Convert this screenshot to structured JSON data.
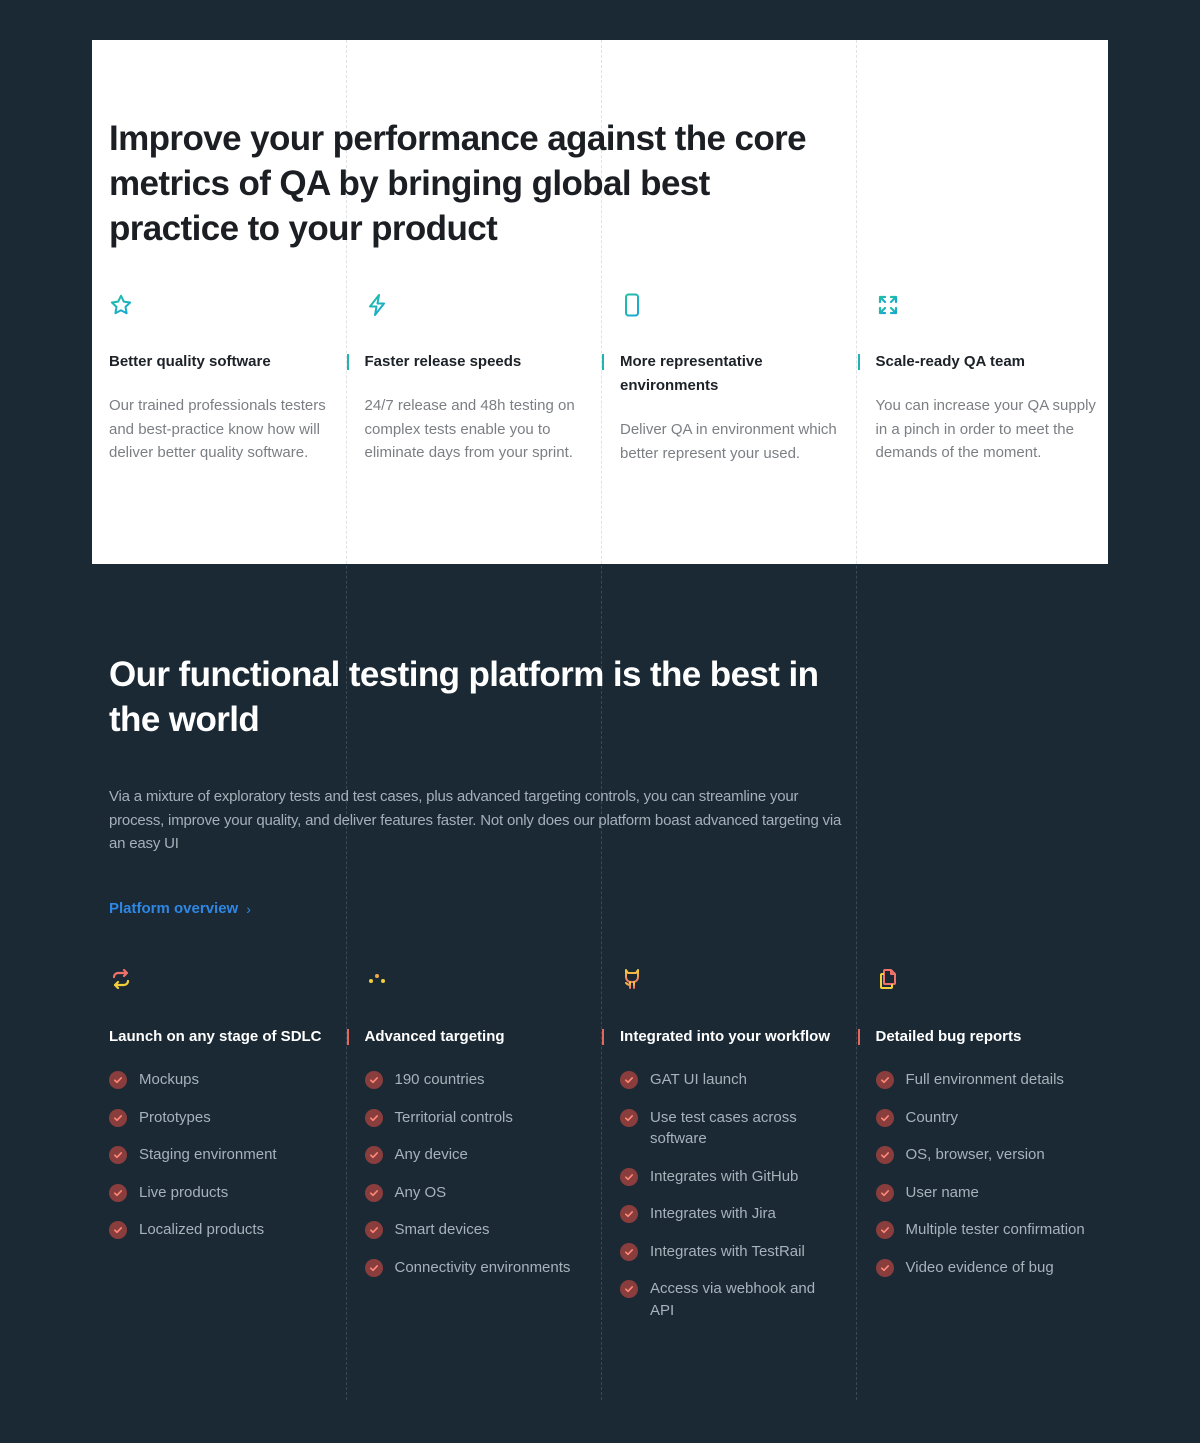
{
  "colors": {
    "page_bg": "#1b2934",
    "card_bg": "#ffffff",
    "teal_accent": "#21b3ad",
    "coral_accent": "#e5675b",
    "link_blue": "#2f87e4",
    "check_bg": "#8a3d3d"
  },
  "core_metrics": {
    "heading": "Improve your performance against the core metrics of QA by bringing global best practice to your product",
    "columns": [
      {
        "icon": "star-icon",
        "title": "Better quality software",
        "description": "Our trained professionals testers and best-practice know how will deliver better quality software."
      },
      {
        "icon": "lightning-icon",
        "title": "Faster release speeds",
        "description": "24/7 release and 48h testing on complex tests enable you to eliminate days from your sprint."
      },
      {
        "icon": "smartphone-icon",
        "title": "More representative environments",
        "description": "Deliver QA in environment which better represent your used."
      },
      {
        "icon": "expand-icon",
        "title": "Scale-ready QA team",
        "description": "You can increase your QA supply in a pinch in order to meet the demands of the moment."
      }
    ]
  },
  "platform": {
    "heading": "Our functional testing platform is the best in the world",
    "intro": "Via a mixture of exploratory tests and test cases, plus advanced targeting controls, you can streamline your process, improve your quality, and deliver features faster. Not only does our platform boast advanced targeting via an easy UI",
    "link_label": "Platform overview",
    "link_chevron": "›",
    "columns": [
      {
        "icon": "refresh-cycle-icon",
        "title": "Launch on any stage of SDLC",
        "items": [
          "Mockups",
          "Prototypes",
          "Staging environment",
          "Live products",
          "Localized products"
        ]
      },
      {
        "icon": "sliders-icon",
        "title": "Advanced targeting",
        "items": [
          "190 countries",
          "Territorial controls",
          "Any device",
          "Any OS",
          "Smart devices",
          "Connectivity environments"
        ]
      },
      {
        "icon": "github-icon",
        "title": "Integrated into your workflow",
        "items": [
          "GAT UI launch",
          "Use test cases across software",
          "Integrates with GitHub",
          "Integrates with Jira",
          "Integrates with TestRail",
          "Access via webhook and API"
        ]
      },
      {
        "icon": "documents-icon",
        "title": "Detailed bug reports",
        "items": [
          "Full environment details",
          "Country",
          "OS, browser, version",
          "User name",
          "Multiple tester confirmation",
          "Video evidence of bug"
        ]
      }
    ]
  }
}
